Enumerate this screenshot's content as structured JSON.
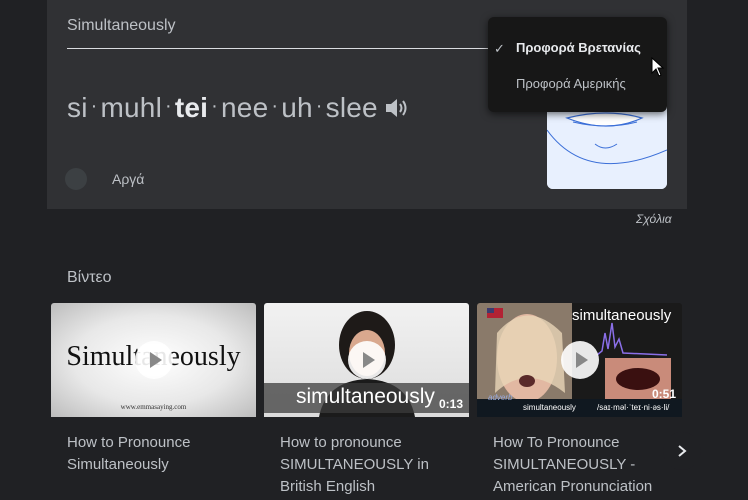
{
  "pronunciation": {
    "word": "Simultaneously",
    "syllables": [
      "si",
      "muhl",
      "tei",
      "nee",
      "uh",
      "slee"
    ],
    "slow_label": "Αργά",
    "accent_menu": {
      "selected": "Προφορά Βρετανίας",
      "other": "Προφορά Αμερικής"
    },
    "feedback": "Σχόλια"
  },
  "videos": {
    "heading": "Βίντεο",
    "items": [
      {
        "title": "How to Pronounce Simultaneously",
        "thumb_text": "Simultaneously",
        "thumb_sub": "www.emmasaying.com",
        "duration": ""
      },
      {
        "title": "How to pronounce SIMULTANEOUSLY in British English",
        "thumb_text": "simultaneously",
        "duration": "0:13"
      },
      {
        "title": "How To Pronounce SIMULTANEOUSLY - American Pronunciation",
        "thumb_text": "simultaneously",
        "thumb_caption": "simultaneously",
        "thumb_ipa": "/saɪ·məl·ˈteɪ·ni·əs·li/",
        "thumb_brand": "adverb",
        "duration": "0:51"
      }
    ]
  },
  "colors": {
    "page_bg": "#202124",
    "card_bg": "#303134",
    "menu_bg": "#171717"
  }
}
